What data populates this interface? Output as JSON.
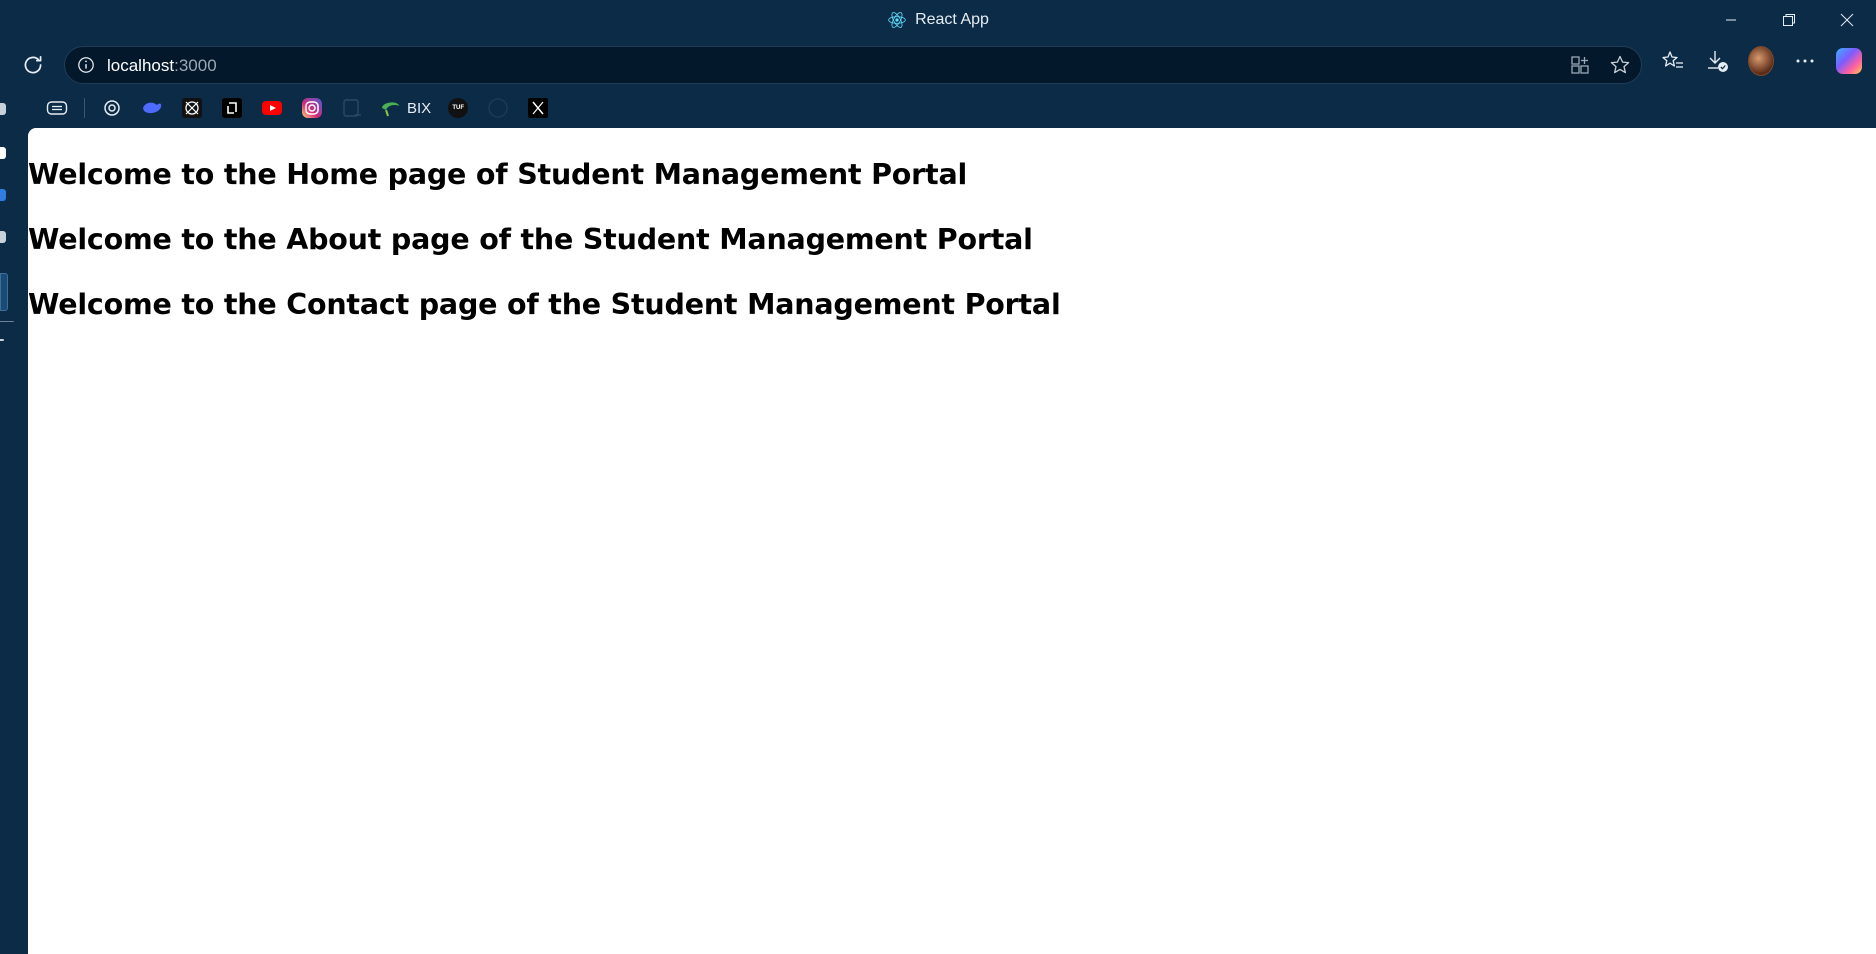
{
  "window": {
    "title": "React App",
    "minimize_glyph": "—",
    "maximize_glyph": "❐",
    "close_glyph": "✕"
  },
  "address_bar": {
    "host": "localhost",
    "port": ":3000"
  },
  "bookmarks": {
    "items": [
      {
        "icon": "collections-icon"
      },
      {
        "icon": "chatgpt-icon"
      },
      {
        "icon": "deepseek-icon"
      },
      {
        "icon": "codeforces-icon"
      },
      {
        "icon": "leetcode-icon"
      },
      {
        "icon": "youtube-icon"
      },
      {
        "icon": "instagram-icon"
      },
      {
        "icon": "github-faded-icon"
      },
      {
        "icon": "bix-icon",
        "label": "BIX"
      },
      {
        "icon": "tuf-icon",
        "badge": "TUF"
      },
      {
        "icon": "github-icon"
      },
      {
        "icon": "x-icon"
      }
    ]
  },
  "page": {
    "headings": [
      "Welcome to the Home page of Student Management Portal",
      "Welcome to the About page of the Student Management Portal",
      "Welcome to the Contact page of the Student Management Portal"
    ]
  },
  "colors": {
    "chrome_bg": "#0c2b47",
    "omnibox_bg": "#04182b",
    "page_bg": "#ffffff"
  }
}
